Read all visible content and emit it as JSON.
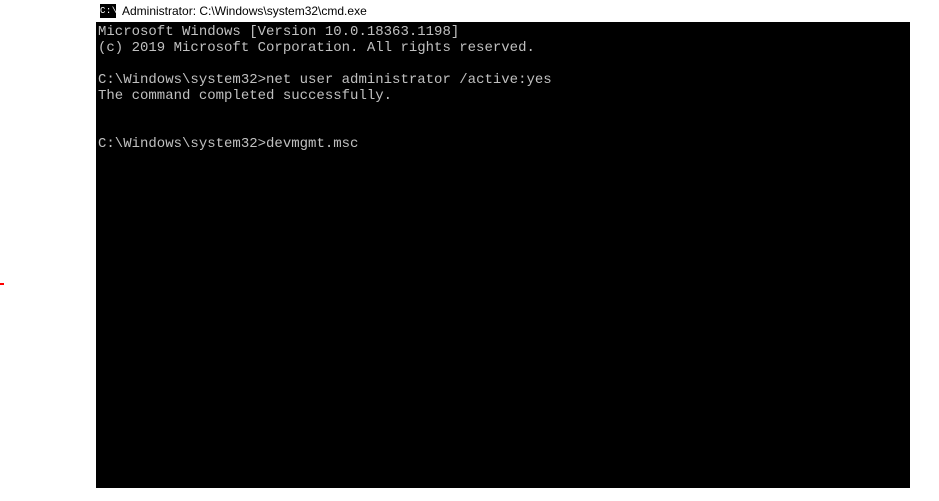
{
  "titlebar": {
    "icon_label": "C:\\",
    "title": "Administrator: C:\\Windows\\system32\\cmd.exe"
  },
  "terminal": {
    "banner_line1": "Microsoft Windows [Version 10.0.18363.1198]",
    "banner_line2": "(c) 2019 Microsoft Corporation. All rights reserved.",
    "blank": "",
    "session1": {
      "prompt": "C:\\Windows\\system32>",
      "command": "net user administrator /active:yes",
      "output": "The command completed successfully."
    },
    "session2": {
      "prompt": "C:\\Windows\\system32>",
      "command": "devmgmt.msc"
    }
  }
}
